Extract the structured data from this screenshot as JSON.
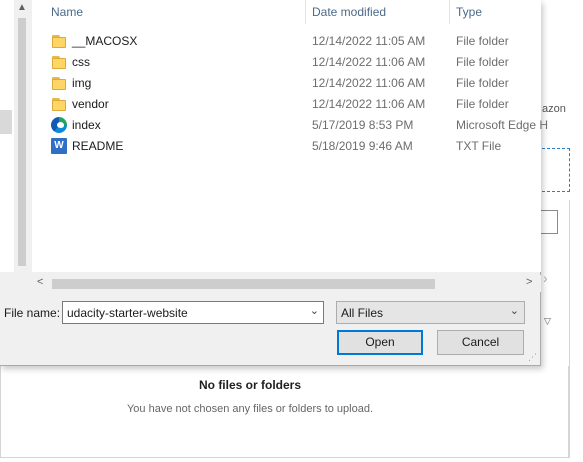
{
  "background": {
    "partial_text": "azon",
    "upload_panel": {
      "title": "No files or folders",
      "subtitle": "You have not chosen any files or folders to upload."
    }
  },
  "dialog": {
    "columns": {
      "name": "Name",
      "date_modified": "Date modified",
      "type": "Type"
    },
    "files": [
      {
        "name": "__MACOSX",
        "date": "12/14/2022 11:05 AM",
        "type": "File folder",
        "icon": "folder-icon"
      },
      {
        "name": "css",
        "date": "12/14/2022 11:06 AM",
        "type": "File folder",
        "icon": "folder-icon"
      },
      {
        "name": "img",
        "date": "12/14/2022 11:06 AM",
        "type": "File folder",
        "icon": "folder-icon"
      },
      {
        "name": "vendor",
        "date": "12/14/2022 11:06 AM",
        "type": "File folder",
        "icon": "folder-icon"
      },
      {
        "name": "index",
        "date": "5/17/2019 8:53 PM",
        "type": "Microsoft Edge H",
        "icon": "edge-html-icon"
      },
      {
        "name": "README",
        "date": "5/18/2019 9:46 AM",
        "type": "TXT File",
        "icon": "text-document-icon"
      }
    ],
    "file_name_label": "File name:",
    "file_name_value": "udacity-starter-website",
    "filter_value": "All Files",
    "open_label": "Open",
    "cancel_label": "Cancel"
  },
  "colors": {
    "accent": "#0078d7",
    "folder": "#ffd666",
    "dialog_bg": "#f0f0f0"
  }
}
